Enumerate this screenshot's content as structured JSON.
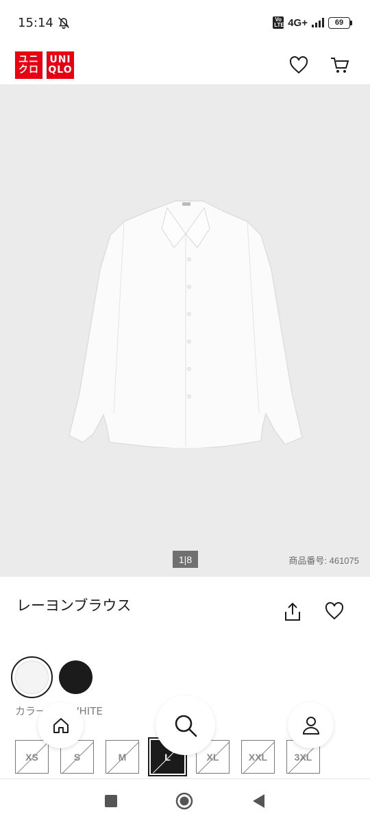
{
  "status_bar": {
    "time": "15:14",
    "volte": "Vo LTE",
    "network": "4G+",
    "battery": "69"
  },
  "header": {
    "logo_line1": "ユニ",
    "logo_line2": "クロ",
    "logo_line3": "UNI",
    "logo_line4": "QLO",
    "brand_color": "#e60012"
  },
  "gallery": {
    "counter": "1|8",
    "product_code": "商品番号: 461075"
  },
  "product": {
    "title": "レーヨンブラウス"
  },
  "colors": {
    "label": "カラー: 00 WHITE",
    "swatches": [
      {
        "name": "WHITE",
        "hex": "#f4f4f4",
        "selected": true
      },
      {
        "name": "BLACK",
        "hex": "#1b1b1b",
        "selected": false
      }
    ]
  },
  "sizes": [
    {
      "label": "XS",
      "available": false,
      "selected": false
    },
    {
      "label": "S",
      "available": false,
      "selected": false
    },
    {
      "label": "M",
      "available": false,
      "selected": false
    },
    {
      "label": "L",
      "available": false,
      "selected": true
    },
    {
      "label": "XL",
      "available": false,
      "selected": false
    },
    {
      "label": "XXL",
      "available": false,
      "selected": false
    },
    {
      "label": "3XL",
      "available": false,
      "selected": false
    }
  ],
  "floating_nav": {
    "icons": [
      "home-icon",
      "search-icon",
      "account-icon"
    ]
  },
  "system_nav": {
    "icons": [
      "recent-apps-icon",
      "home-icon",
      "back-icon"
    ]
  }
}
